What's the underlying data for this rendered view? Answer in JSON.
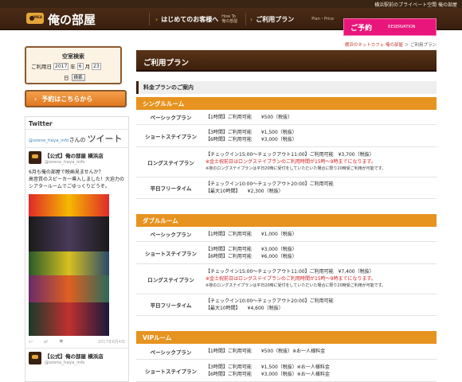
{
  "topbar": {
    "tagline": "横浜駅前のプライベート空間 俺の部屋"
  },
  "header": {
    "logo_text": "俺の部屋",
    "logo_badge": "OREA",
    "nav": [
      {
        "label": "はじめてのお客様へ",
        "sub1": "How To",
        "sub2": "俺の部屋"
      },
      {
        "label": "ご利用プラン",
        "sub1": "Plan・Price",
        "sub2": ""
      }
    ],
    "reserve": {
      "label": "ご予約",
      "sub": "RESERVATION"
    }
  },
  "sidebar": {
    "search": {
      "title": "空室検索",
      "date_label": "ご利用日",
      "year": "2017",
      "year_unit": "年",
      "month": "6",
      "month_unit": "月",
      "day": "23",
      "day_unit": "日",
      "button": "検索"
    },
    "book_button": "予約はこちらから",
    "twitter": {
      "heading": "Twitter",
      "handle": "@oreno_heya_info",
      "suffix": "さんの",
      "big": "ツイート",
      "tweets": [
        {
          "name": "【公式】俺の部屋 横浜店",
          "id": "@oreno_heya_info",
          "lines": [
            "6月も俺の部屋で映画見ませんか？",
            "高音質のスピーカー導入しました！大迫力の",
            "シアタールームでごゆっくりどうぞ。"
          ],
          "date": "2017年6月4日"
        },
        {
          "name": "【公式】俺の部屋 横浜店",
          "id": "@oreno_heya_info"
        }
      ]
    }
  },
  "main": {
    "breadcrumb": {
      "link": "横浜のネットカフェ 俺の部屋",
      "sep": "＞",
      "current": "ご利用プラン"
    },
    "title": "ご利用プラン",
    "section": "料金プランのご案内",
    "rooms": [
      {
        "name": "シングルルーム",
        "plans": [
          {
            "name": "ベーシックプラン",
            "lines": [
              {
                "t": "【1時間】ご利用可能　　¥500（税抜）"
              }
            ]
          },
          {
            "name": "ショートステイプラン",
            "lines": [
              {
                "t": "【3時間】ご利用可能　　¥1,500（税抜）"
              },
              {
                "t": "【6時間】ご利用可能　　¥3,000（税抜）"
              }
            ]
          },
          {
            "name": "ロングステイプラン",
            "lines": [
              {
                "t": "【チェックイン15:00〜チェックアウト11:00】ご利用可能　¥3,700（税抜）"
              },
              {
                "t": "※金土祝前日はロングステイプランのご利用時間が15時〜9時までになります。",
                "red": true
              },
              {
                "t": "※夜のロングステイプランは平日20時に受付をしていただいた場合に限り20時受ご利用が可能です。",
                "small": true
              }
            ]
          },
          {
            "name": "平日フリータイム",
            "lines": [
              {
                "t": "【チェックイン10:00〜チェックアウト20:00】ご利用可能"
              },
              {
                "t": "【最大10時間】　　¥2,300（税抜）"
              }
            ]
          }
        ]
      },
      {
        "name": "ダブルルーム",
        "plans": [
          {
            "name": "ベーシックプラン",
            "lines": [
              {
                "t": "【1時間】ご利用可能　　¥1,000（税抜）"
              }
            ]
          },
          {
            "name": "ショートステイプラン",
            "lines": [
              {
                "t": "【3時間】ご利用可能　　¥3,000（税抜）"
              },
              {
                "t": "【6時間】ご利用可能　　¥6,000（税抜）"
              }
            ]
          },
          {
            "name": "ロングステイプラン",
            "lines": [
              {
                "t": "【チェックイン15:00〜チェックアウト11:00】ご利用可能　¥7,400（税抜）"
              },
              {
                "t": "※金土祝前日はロングステイプランのご利用時間が15時〜9時までになります。",
                "red": true
              },
              {
                "t": "※夜のロングステイプランは平日20時に受付をしていただいた場合に限り20時受ご利用が可能です。",
                "small": true
              }
            ]
          },
          {
            "name": "平日フリータイム",
            "lines": [
              {
                "t": "【チェックイン10:00〜チェックアウト20:00】ご利用可能"
              },
              {
                "t": "【最大10時間】　　¥4,600（税抜）"
              }
            ]
          }
        ]
      },
      {
        "name": "VIPルーム",
        "plans": [
          {
            "name": "ベーシックプラン",
            "lines": [
              {
                "t": "【1時間】ご利用可能　　¥500（税抜）※お一人様料金"
              }
            ]
          },
          {
            "name": "ショートステイプラン",
            "lines": [
              {
                "t": "【3時間】ご利用可能　　¥1,500（税抜）※お一人様料金"
              },
              {
                "t": "【6時間】ご利用可能　　¥3,000（税抜）※お一人様料金"
              }
            ]
          }
        ]
      }
    ]
  }
}
